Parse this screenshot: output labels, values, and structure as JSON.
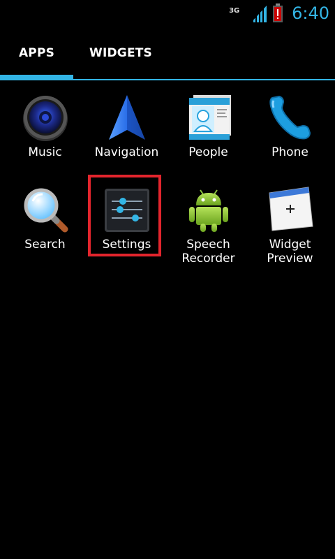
{
  "status_bar": {
    "network": "3G",
    "time": "6:40",
    "accent": "#33b5e5"
  },
  "tabs": [
    {
      "label": "APPS",
      "selected": true
    },
    {
      "label": "WIDGETS",
      "selected": false
    }
  ],
  "apps": [
    {
      "label": "Music",
      "icon": "speaker-icon"
    },
    {
      "label": "Navigation",
      "icon": "navigation-arrow-icon"
    },
    {
      "label": "People",
      "icon": "contacts-card-icon"
    },
    {
      "label": "Phone",
      "icon": "phone-handset-icon"
    },
    {
      "label": "Search",
      "icon": "magnifier-icon"
    },
    {
      "label": "Settings",
      "icon": "sliders-icon",
      "highlighted": true
    },
    {
      "label": "Speech\nRecorder",
      "icon": "android-robot-icon"
    },
    {
      "label": "Widget\nPreview",
      "icon": "widget-preview-icon"
    }
  ],
  "highlight_color": "#e3252d"
}
